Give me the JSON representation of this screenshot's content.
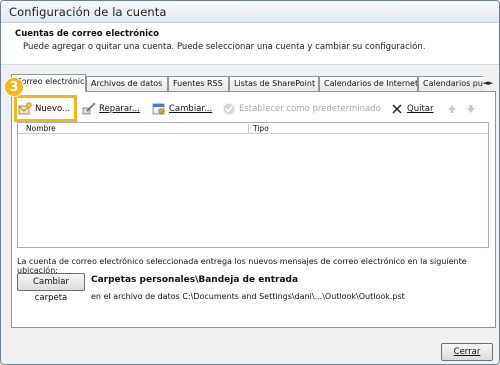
{
  "window": {
    "title": "Configuración de la cuenta"
  },
  "header": {
    "title": "Cuentas de correo electrónico",
    "description": "Puede agregar o quitar una cuenta. Puede seleccionar una cuenta y cambiar su configuración."
  },
  "tabs": [
    {
      "label": "Correo electrónico",
      "active": true
    },
    {
      "label": "Archivos de datos",
      "active": false
    },
    {
      "label": "Fuentes RSS",
      "active": false
    },
    {
      "label": "Listas de SharePoint",
      "active": false
    },
    {
      "label": "Calendarios de Internet",
      "active": false
    },
    {
      "label": "Calendarios publicad",
      "active": false
    }
  ],
  "tab_scroll": {
    "left": "◄",
    "right": "►"
  },
  "toolbar": {
    "new_label": "Nuevo...",
    "repair_label": "Reparar...",
    "change_label": "Cambiar...",
    "default_label": "Establecer como predeterminado",
    "remove_label": "Quitar"
  },
  "step_badge": "3",
  "list": {
    "columns": [
      "Nombre",
      "Tipo"
    ],
    "rows": []
  },
  "delivery": {
    "info": "La cuenta de correo electrónico seleccionada entrega los nuevos mensajes de correo electrónico en la siguiente ubicación:",
    "change_folder_label": "Cambiar carpeta",
    "folder": "Carpetas personales\\Bandeja de entrada",
    "file": "en el archivo de datos C:\\Documents and Settings\\dani\\...\\Outlook\\Outlook.pst"
  },
  "footer": {
    "close_label": "Cerrar"
  },
  "colors": {
    "highlight": "#f0b81b",
    "accent": "#2e7d32"
  }
}
